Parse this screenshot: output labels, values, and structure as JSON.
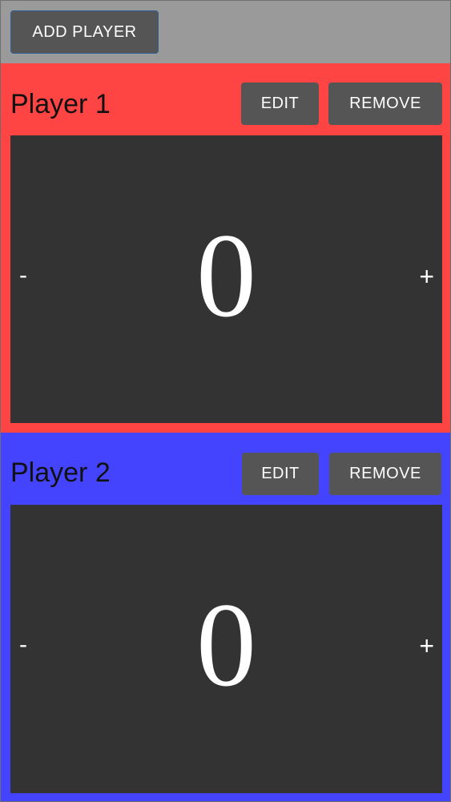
{
  "toolbar": {
    "add_player_label": "ADD PLAYER"
  },
  "players": [
    {
      "name": "Player 1",
      "color": "#ff4444",
      "edit_label": "EDIT",
      "remove_label": "REMOVE",
      "score": "0",
      "minus_label": "-",
      "plus_label": "+"
    },
    {
      "name": "Player 2",
      "color": "#4444ff",
      "edit_label": "EDIT",
      "remove_label": "REMOVE",
      "score": "0",
      "minus_label": "-",
      "plus_label": "+"
    }
  ],
  "colors": {
    "toolbar_bg": "#9a9a9a",
    "button_bg": "#555555",
    "panel_bg": "#333333"
  }
}
